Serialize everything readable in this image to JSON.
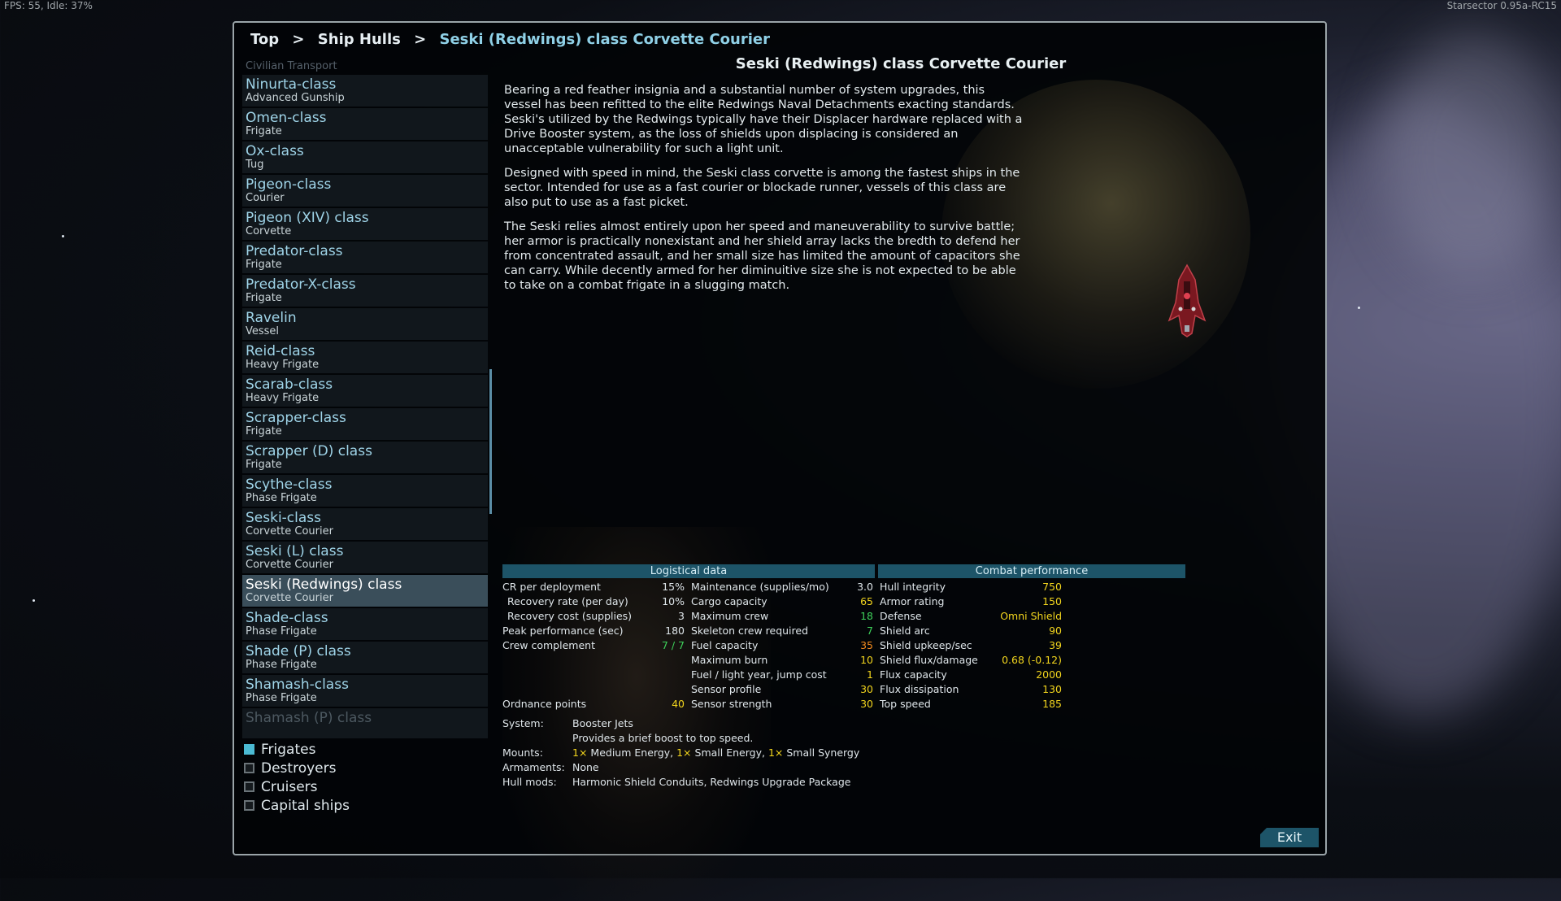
{
  "hud": {
    "fps": "FPS: 55, Idle: 37%",
    "version": "Starsector 0.95a-RC15"
  },
  "breadcrumb": [
    "Top",
    "Ship Hulls",
    "Seski (Redwings) class Corvette Courier"
  ],
  "list": {
    "faded_top": "Civilian Transport",
    "items": [
      {
        "name": "Ninurta-class",
        "sub": "Advanced Gunship"
      },
      {
        "name": "Omen-class",
        "sub": "Frigate"
      },
      {
        "name": "Ox-class",
        "sub": "Tug"
      },
      {
        "name": "Pigeon-class",
        "sub": "Courier"
      },
      {
        "name": "Pigeon (XIV) class",
        "sub": "Corvette"
      },
      {
        "name": "Predator-class",
        "sub": "Frigate"
      },
      {
        "name": "Predator-X-class",
        "sub": "Frigate"
      },
      {
        "name": "Ravelin",
        "sub": "Vessel"
      },
      {
        "name": "Reid-class",
        "sub": "Heavy Frigate"
      },
      {
        "name": "Scarab-class",
        "sub": "Heavy Frigate"
      },
      {
        "name": "Scrapper-class",
        "sub": "Frigate"
      },
      {
        "name": "Scrapper (D) class",
        "sub": "Frigate"
      },
      {
        "name": "Scythe-class",
        "sub": "Phase Frigate"
      },
      {
        "name": "Seski-class",
        "sub": "Corvette Courier"
      },
      {
        "name": "Seski (L) class",
        "sub": "Corvette Courier"
      },
      {
        "name": "Seski (Redwings) class",
        "sub": "Corvette Courier"
      },
      {
        "name": "Shade-class",
        "sub": "Phase Frigate"
      },
      {
        "name": "Shade (P) class",
        "sub": "Phase Frigate"
      },
      {
        "name": "Shamash-class",
        "sub": "Phase Frigate"
      },
      {
        "name": "Shamash (P) class",
        "sub": ""
      }
    ],
    "selected_index": 15
  },
  "filters": [
    {
      "label": "Frigates",
      "checked": true
    },
    {
      "label": "Destroyers",
      "checked": false
    },
    {
      "label": "Cruisers",
      "checked": false
    },
    {
      "label": "Capital ships",
      "checked": false
    }
  ],
  "ship": {
    "title": "Seski (Redwings) class Corvette Courier",
    "desc1": "Bearing a red feather insignia and a substantial number of system upgrades, this vessel has been refitted to the elite Redwings Naval Detachments exacting standards. Seski's utilized by the Redwings typically have their Displacer hardware replaced with a Drive Booster system, as the loss of shields upon displacing is considered an unacceptable vulnerability for such a light unit.",
    "desc2": "Designed with speed in mind, the Seski class corvette is among the fastest ships in the sector. Intended for use as a fast courier or blockade runner, vessels of this class are also put to use as a fast picket.",
    "desc3": "The Seski relies almost entirely upon her speed and maneuverability to survive battle; her armor is practically nonexistant and her shield array lacks the bredth to defend her from concentrated assault, and her small size has limited the amount of capacitors she can carry. While decently armed for her diminuitive size she is not expected to be able to take on a combat frigate in a slugging match."
  },
  "stats": {
    "logistical_header": "Logistical data",
    "combat_header": "Combat performance",
    "col1": [
      {
        "label": "CR per deployment",
        "value": "15%"
      },
      {
        "label": "Recovery rate (per day)",
        "value": "10%"
      },
      {
        "label": "Recovery cost (supplies)",
        "value": "3"
      },
      {
        "label": "Peak performance (sec)",
        "value": "180"
      },
      {
        "label": "Crew complement",
        "value": "7 / 7"
      },
      {
        "label": "Ordnance points",
        "value": "40"
      }
    ],
    "col2": [
      {
        "label": "Maintenance (supplies/mo)",
        "value": "3.0"
      },
      {
        "label": "Cargo capacity",
        "value": "65"
      },
      {
        "label": "Maximum crew",
        "value": "18"
      },
      {
        "label": "Skeleton crew required",
        "value": "7"
      },
      {
        "label": "Fuel capacity",
        "value": "35"
      },
      {
        "label": "Maximum burn",
        "value": "10"
      },
      {
        "label": "Fuel / light year, jump cost",
        "value": "1"
      },
      {
        "label": "Sensor profile",
        "value": "30"
      },
      {
        "label": "Sensor strength",
        "value": "30"
      }
    ],
    "col3": [
      {
        "label": "Hull integrity",
        "value": "750"
      },
      {
        "label": "Armor rating",
        "value": "150"
      },
      {
        "label": "Defense",
        "value": "Omni Shield"
      },
      {
        "label": "Shield arc",
        "value": "90"
      },
      {
        "label": "Shield upkeep/sec",
        "value": "39"
      },
      {
        "label": "Shield flux/damage",
        "value": "0.68 (-0.12)"
      },
      {
        "label": "Flux capacity",
        "value": "2000"
      },
      {
        "label": "Flux dissipation",
        "value": "130"
      },
      {
        "label": "Top speed",
        "value": "185"
      }
    ],
    "system_label": "System:",
    "system_value": "Booster Jets",
    "system_desc": "Provides a brief boost to top speed.",
    "mounts_label": "Mounts:",
    "mounts": [
      {
        "count": "1×",
        "type": "Medium Energy,"
      },
      {
        "count": "1×",
        "type": "Small Energy,"
      },
      {
        "count": "1×",
        "type": "Small Synergy"
      }
    ],
    "armaments_label": "Armaments:",
    "armaments_value": "None",
    "hullmods_label": "Hull mods:",
    "hullmods_value": "Harmonic Shield Conduits, Redwings Upgrade Package"
  },
  "exit_label": "Exit",
  "colors": {
    "accent": "#1d5468",
    "highlight": "#f2d51d",
    "positive": "#3ed15a",
    "warning": "#f28a1e"
  }
}
